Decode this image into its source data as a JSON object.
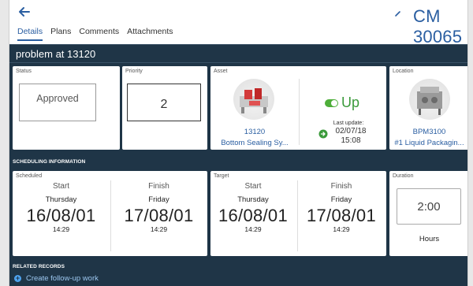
{
  "header": {
    "work_order_title": "CM 30065",
    "tabs": [
      {
        "label": "Details",
        "active": true
      },
      {
        "label": "Plans",
        "active": false
      },
      {
        "label": "Comments",
        "active": false
      },
      {
        "label": "Attachments",
        "active": false
      }
    ]
  },
  "headline": "problem at 13120",
  "status_card": {
    "label": "Status",
    "value": "Approved"
  },
  "priority_card": {
    "label": "Priority",
    "value": "2"
  },
  "asset_card": {
    "label": "Asset",
    "asset_number": "13120",
    "asset_description": "Bottom Sealing Sy...",
    "status": "Up",
    "last_update_label": "Last update:",
    "last_update_date": "02/07/18",
    "last_update_time": "15:08"
  },
  "location_card": {
    "label": "Location",
    "location_code": "BPM3100",
    "location_description": "#1 Liquid Packagin..."
  },
  "scheduling": {
    "section_title": "SCHEDULING INFORMATION",
    "scheduled": {
      "label": "Scheduled",
      "start": {
        "label": "Start",
        "day": "Thursday",
        "date": "16/08/01",
        "time": "14:29"
      },
      "finish": {
        "label": "Finish",
        "day": "Friday",
        "date": "17/08/01",
        "time": "14:29"
      }
    },
    "target": {
      "label": "Target",
      "start": {
        "label": "Start",
        "day": "Thursday",
        "date": "16/08/01",
        "time": "14:29"
      },
      "finish": {
        "label": "Finish",
        "day": "Friday",
        "date": "17/08/01",
        "time": "14:29"
      }
    },
    "duration": {
      "label": "Duration",
      "value": "2:00",
      "unit": "Hours"
    }
  },
  "related_records": {
    "section_title": "RELATED RECORDS",
    "create_follow_up": "Create follow-up work"
  },
  "colors": {
    "accent": "#2a5ea1",
    "dark_background": "#1f3547",
    "status_up": "#3a9a3a"
  },
  "icons": {
    "back": "back-arrow-icon",
    "edit": "pencil-icon",
    "status_up": "toggle-on-icon",
    "update": "arrow-right-circle-icon",
    "add": "plus-circle-icon"
  }
}
